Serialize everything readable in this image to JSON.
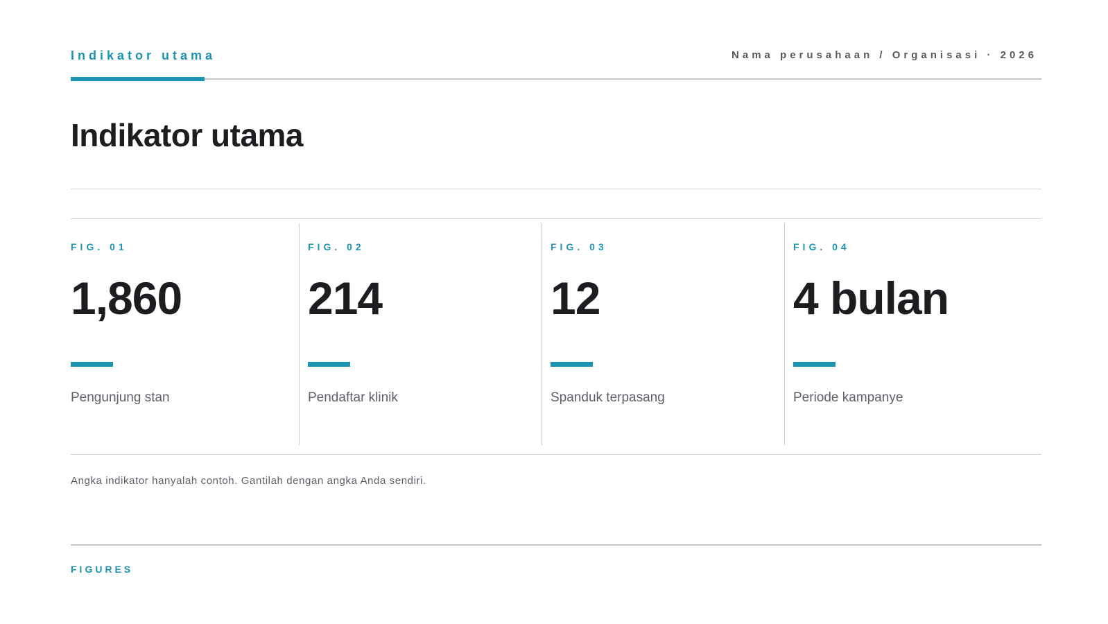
{
  "header": {
    "section_label": "Indikator utama",
    "meta": "Nama perusahaan / Organisasi · 2026"
  },
  "title": "Indikator utama",
  "figures": [
    {
      "tag": "FIG. 01",
      "value": "1,860",
      "label": "Pengunjung stan"
    },
    {
      "tag": "FIG. 02",
      "value": "214",
      "label": "Pendaftar klinik"
    },
    {
      "tag": "FIG. 03",
      "value": "12",
      "label": "Spanduk terpasang"
    },
    {
      "tag": "FIG. 04",
      "value": "4 bulan",
      "label": "Periode kampanye"
    }
  ],
  "footnote": "Angka indikator hanyalah contoh. Gantilah dengan angka Anda sendiri.",
  "footer": {
    "label": "FIGURES"
  },
  "colors": {
    "accent": "#1b93b2",
    "text_dark": "#1c1d21",
    "text_muted": "#5d6068",
    "rule": "#c4c6ca"
  }
}
